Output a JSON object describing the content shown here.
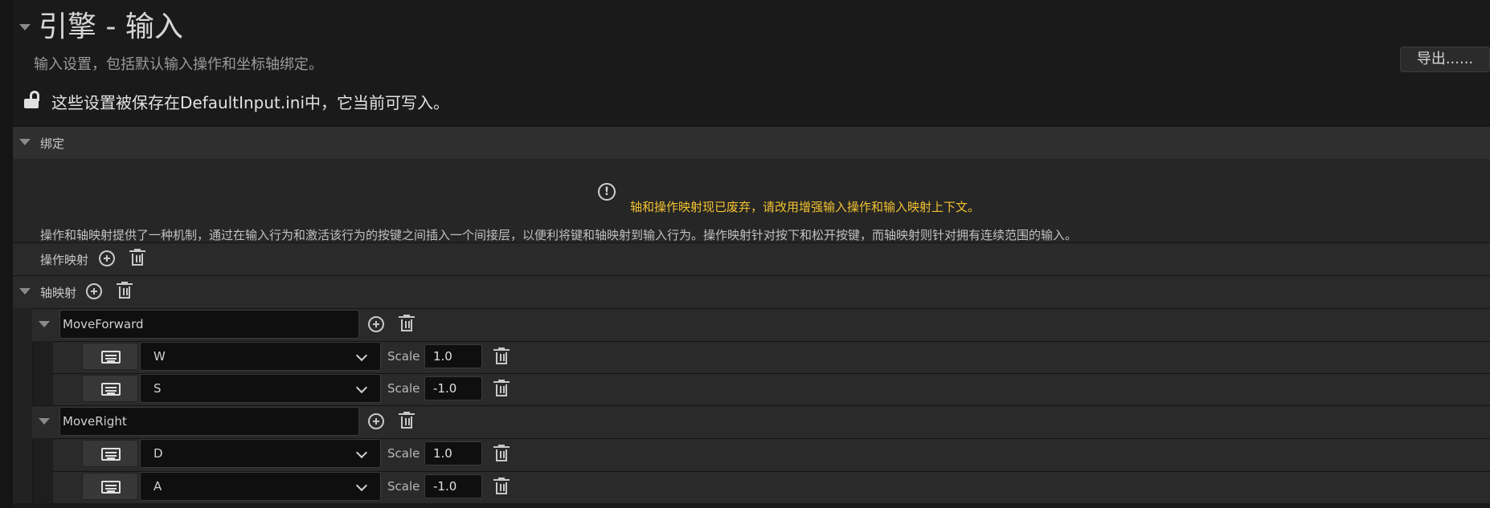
{
  "header": {
    "title": "引擎 - 输入",
    "subtitle": "输入设置，包括默认输入操作和坐标轴绑定。",
    "export_label": "导出......",
    "notice": "这些设置被保存在DefaultInput.ini中，它当前可写入。",
    "lock_icon": "unlocked-padlock-icon"
  },
  "bindings": {
    "label": "绑定",
    "warning": "轴和操作映射现已废弃，请改用增强输入操作和输入映射上下文。",
    "description": "操作和轴映射提供了一种机制，通过在输入行为和激活该行为的按键之间插入一个间接层，以便利将键和轴映射到输入行为。操作映射针对按下和松开按键，而轴映射则针对拥有连续范围的输入。",
    "action_mappings_label": "操作映射",
    "axis_mappings_label": "轴映射",
    "warning_color": "#f2c230"
  },
  "axis_mappings": [
    {
      "name": "MoveForward",
      "keys": [
        {
          "key": "W",
          "scale_label": "Scale",
          "scale": "1.0"
        },
        {
          "key": "S",
          "scale_label": "Scale",
          "scale": "-1.0"
        }
      ]
    },
    {
      "name": "MoveRight",
      "keys": [
        {
          "key": "D",
          "scale_label": "Scale",
          "scale": "1.0"
        },
        {
          "key": "A",
          "scale_label": "Scale",
          "scale": "-1.0"
        }
      ]
    }
  ]
}
